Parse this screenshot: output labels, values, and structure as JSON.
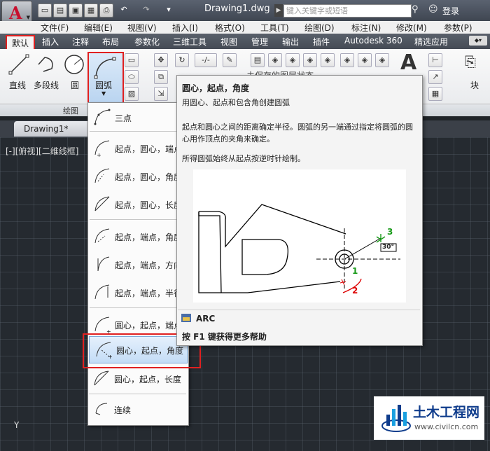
{
  "title_bar": {
    "doc_title": "Drawing1.dwg",
    "search_placeholder": "键入关键字或短语",
    "login": "登录",
    "qa_icons": [
      "new-icon",
      "open-icon",
      "save-icon",
      "saveas-icon",
      "print-icon",
      "undo-icon",
      "redo-icon",
      "more-icon"
    ]
  },
  "menu": [
    "文件(F)",
    "编辑(E)",
    "视图(V)",
    "插入(I)",
    "格式(O)",
    "工具(T)",
    "绘图(D)",
    "标注(N)",
    "修改(M)",
    "参数(P)"
  ],
  "ribbon_tabs": [
    "默认",
    "插入",
    "注释",
    "布局",
    "参数化",
    "三维工具",
    "视图",
    "管理",
    "输出",
    "插件",
    "Autodesk 360",
    "精选应用"
  ],
  "ribbon": {
    "line": "直线",
    "polyline": "多段线",
    "circle": "圆",
    "arc": "圆弧",
    "block": "块",
    "draw_panel": "绘图",
    "hidden_text": "未保存的图层状态",
    "text_glyph": "A"
  },
  "doc_tab": "Drawing1*",
  "viewport_label": "[-][俯视][二维线框]",
  "ucs_y": "Y",
  "arc_menu": [
    "三点",
    "起点，圆心，端点",
    "起点，圆心，角度",
    "起点，圆心，长度",
    "起点，端点，角度",
    "起点，端点，方向",
    "起点，端点，半径",
    "圆心，起点，端点",
    "圆心，起点，角度",
    "圆心，起点，长度",
    "连续"
  ],
  "tooltip": {
    "title": "圆心，起点，角度",
    "desc": "用圆心、起点和包含角创建圆弧",
    "detail": "起点和圆心之间的距离确定半径。圆弧的另一端通过指定将圆弧的圆心用作顶点的夹角来确定。",
    "note": "所得圆弧始终从起点按逆时针绘制。",
    "fig_labels": [
      "1",
      "2",
      "3",
      "30°"
    ],
    "command": "ARC",
    "help": "按 F1 键获得更多帮助"
  },
  "watermark": {
    "title": "土木工程网",
    "url": "www.civilcn.com"
  }
}
